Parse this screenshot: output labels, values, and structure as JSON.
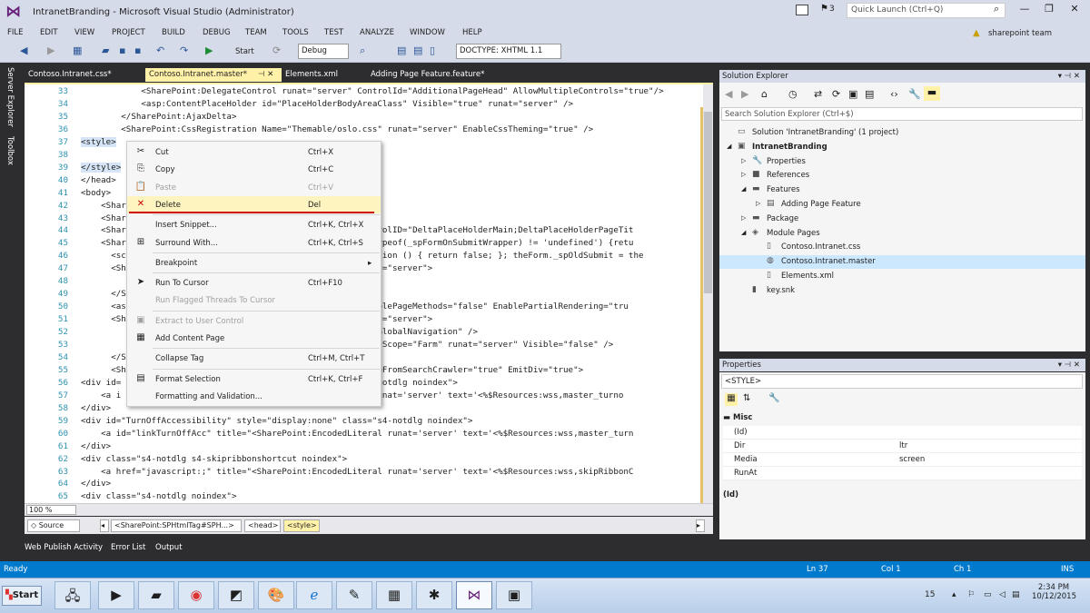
{
  "window": {
    "title": "IntranetBranding - Microsoft Visual Studio (Administrator)",
    "notification_count": "3",
    "quick_launch_placeholder": "Quick Launch (Ctrl+Q)",
    "user": "sharepoint team"
  },
  "menu": [
    "FILE",
    "EDIT",
    "VIEW",
    "PROJECT",
    "BUILD",
    "DEBUG",
    "TEAM",
    "TOOLS",
    "TEST",
    "ANALYZE",
    "WINDOW",
    "HELP"
  ],
  "toolbar": {
    "start_label": "Start",
    "config": "Debug",
    "doctype": "DOCTYPE: XHTML 1.1"
  },
  "side_tabs": [
    "Server Explorer",
    "Toolbox"
  ],
  "doc_tabs": [
    {
      "label": "Contoso.Intranet.css*"
    },
    {
      "label": "Contoso.Intranet.master*"
    },
    {
      "label": "Elements.xml"
    },
    {
      "label": "Adding Page Feature.feature*"
    }
  ],
  "editor": {
    "lines": [
      {
        "n": "33",
        "t": "<SharePoint:DelegateControl runat=\"server\" ControlId=\"AdditionalPageHead\" AllowMultipleControls=\"true\"/>",
        "i": "            "
      },
      {
        "n": "34",
        "t": "<asp:ContentPlaceHolder id=\"PlaceHolderBodyAreaClass\" Visible=\"true\" runat=\"server\" />",
        "i": "            "
      },
      {
        "n": "35",
        "t": "</SharePoint:AjaxDelta>",
        "i": "        "
      },
      {
        "n": "36",
        "t": "<SharePoint:CssRegistration Name=\"Themable/oslo.css\" runat=\"server\" EnableCssTheming=\"true\" />",
        "i": "        "
      },
      {
        "n": "37",
        "t": "<style>",
        "i": ""
      },
      {
        "n": "38",
        "t": "",
        "i": ""
      },
      {
        "n": "39",
        "t": "</style>",
        "i": ""
      },
      {
        "n": "40",
        "t": "</head>",
        "i": ""
      },
      {
        "n": "41",
        "t": "<body>",
        "i": ""
      },
      {
        "n": "42",
        "t": "<Share",
        "i": "    "
      },
      {
        "n": "43",
        "t": "<Share",
        "i": "    "
      },
      {
        "n": "44",
        "t": "<Share                                           erControlID=\"DeltaPlaceHolderMain;DeltaPlaceHolderPageTit",
        "i": "    "
      },
      {
        "n": "45",
        "t": "<Share                                           \"if (typeof(_spFormOnSubmitWrapper) != 'undefined') {retu",
        "i": "    "
      },
      {
        "n": "46",
        "t": "<scr                                             function () { return false; }; theForm._spOldSubmit = the",
        "i": "      "
      },
      {
        "n": "47",
        "t": "<Sha                                             runat=\"server\">",
        "i": "      "
      },
      {
        "n": "48",
        "t": "",
        "i": ""
      },
      {
        "n": "49",
        "t": "</Sh",
        "i": "      "
      },
      {
        "n": "50",
        "t": "<asp                                           r\" EnablePageMethods=\"false\" EnablePartialRendering=\"tru",
        "i": "      "
      },
      {
        "n": "51",
        "t": "<Sha                                             runat=\"server\">",
        "i": "      "
      },
      {
        "n": "52",
        "t": "                                                 ontrolId=\"GlobalNavigation\" />",
        "i": ""
      },
      {
        "n": "53",
        "t": "                                                 SiteLink3\" Scope=\"Farm\" runat=\"server\" Visible=\"false\" />",
        "i": ""
      },
      {
        "n": "54",
        "t": "</Sh",
        "i": "      "
      },
      {
        "n": "55",
        "t": "<Sha                                            \" HideFromSearchCrawler=\"true\" EmitDiv=\"true\">",
        "i": "      "
      },
      {
        "n": "56",
        "t": "<div id=                                          lass=\"s4-notdlg noindex\">",
        "i": ""
      },
      {
        "n": "57",
        "t": "<a i                                           iteral runat='server' text='<%$Resources:wss,master_turno",
        "i": "    "
      },
      {
        "n": "58",
        "t": "</div>",
        "i": ""
      },
      {
        "n": "59",
        "t": "<div id=\"TurnOffAccessibility\" style=\"display:none\" class=\"s4-notdlg noindex\">",
        "i": ""
      },
      {
        "n": "60",
        "t": "<a id=\"linkTurnOffAcc\" title=\"<SharePoint:EncodedLiteral runat='server' text='<%$Resources:wss,master_turn",
        "i": "    "
      },
      {
        "n": "61",
        "t": "</div>",
        "i": ""
      },
      {
        "n": "62",
        "t": "<div class=\"s4-notdlg s4-skipribbonshortcut noindex\">",
        "i": ""
      },
      {
        "n": "63",
        "t": "<a href=\"javascript:;\" title=\"<SharePoint:EncodedLiteral runat='server' text='<%$Resources:wss,skipRibbonC",
        "i": "    "
      },
      {
        "n": "64",
        "t": "</div>",
        "i": ""
      },
      {
        "n": "65",
        "t": "<div class=\"s4-notdlg noindex\">",
        "i": ""
      }
    ],
    "zoom": "100 %",
    "source_tab": "Source",
    "breadcrumbs": [
      "<SharePoint:SPHtmlTag#SPH...>",
      "<head>",
      "<style>"
    ]
  },
  "context_menu": [
    {
      "icon": "scissors-icon",
      "glyph": "✂",
      "label": "Cut",
      "shortcut": "Ctrl+X",
      "disabled": false
    },
    {
      "icon": "copy-icon",
      "glyph": "⎘",
      "label": "Copy",
      "shortcut": "Ctrl+C",
      "disabled": false
    },
    {
      "icon": "paste-icon",
      "glyph": "📋",
      "label": "Paste",
      "shortcut": "Ctrl+V",
      "disabled": true
    },
    {
      "icon": "delete-icon",
      "glyph": "✕",
      "label": "Delete",
      "shortcut": "Del",
      "disabled": false,
      "highlight": true
    },
    {
      "sep": true
    },
    {
      "icon": "snippet-icon",
      "glyph": "",
      "label": "Insert Snippet...",
      "shortcut": "Ctrl+K, Ctrl+X",
      "disabled": false
    },
    {
      "icon": "surround-icon",
      "glyph": "⊞",
      "label": "Surround With...",
      "shortcut": "Ctrl+K, Ctrl+S",
      "disabled": false
    },
    {
      "sep": true
    },
    {
      "icon": "",
      "glyph": "",
      "label": "Breakpoint",
      "shortcut": "▸",
      "disabled": false
    },
    {
      "sep": true
    },
    {
      "icon": "run-cursor-icon",
      "glyph": "➤",
      "label": "Run To Cursor",
      "shortcut": "Ctrl+F10",
      "disabled": false
    },
    {
      "icon": "run-flagged-icon",
      "glyph": "",
      "label": "Run Flagged Threads To Cursor",
      "shortcut": "",
      "disabled": true
    },
    {
      "sep": true
    },
    {
      "icon": "extract-icon",
      "glyph": "▣",
      "label": "Extract to User Control",
      "shortcut": "",
      "disabled": true
    },
    {
      "icon": "add-page-icon",
      "glyph": "▦",
      "label": "Add Content Page",
      "shortcut": "",
      "disabled": false
    },
    {
      "sep": true
    },
    {
      "icon": "",
      "glyph": "",
      "label": "Collapse Tag",
      "shortcut": "Ctrl+M, Ctrl+T",
      "disabled": false
    },
    {
      "sep": true
    },
    {
      "icon": "format-icon",
      "glyph": "▤",
      "label": "Format Selection",
      "shortcut": "Ctrl+K, Ctrl+F",
      "disabled": false
    },
    {
      "icon": "",
      "glyph": "",
      "label": "Formatting and Validation...",
      "shortcut": "",
      "disabled": false
    }
  ],
  "solution_explorer": {
    "title": "Solution Explorer",
    "search_placeholder": "Search Solution Explorer (Ctrl+$)",
    "nodes": [
      {
        "label": "Solution 'IntranetBranding' (1 project)",
        "level": 0,
        "icon": "solution-icon",
        "glyph": "▭",
        "arrow": ""
      },
      {
        "label": "IntranetBranding",
        "level": 0,
        "icon": "project-icon",
        "glyph": "▣",
        "arrow": "◢",
        "bold": true
      },
      {
        "label": "Properties",
        "level": 1,
        "icon": "wrench-icon",
        "glyph": "🔧",
        "arrow": "▷"
      },
      {
        "label": "References",
        "level": 1,
        "icon": "references-icon",
        "glyph": "■",
        "arrow": "▷"
      },
      {
        "label": "Features",
        "level": 1,
        "icon": "folder-icon",
        "glyph": "▬",
        "arrow": "◢"
      },
      {
        "label": "Adding Page Feature",
        "level": 2,
        "icon": "feature-icon",
        "glyph": "▤",
        "arrow": "▷"
      },
      {
        "label": "Package",
        "level": 1,
        "icon": "package-icon",
        "glyph": "▬",
        "arrow": "▷"
      },
      {
        "label": "Module Pages",
        "level": 1,
        "icon": "module-icon",
        "glyph": "◈",
        "arrow": "◢"
      },
      {
        "label": "Contoso.Intranet.css",
        "level": 2,
        "icon": "css-file-icon",
        "glyph": "▯",
        "arrow": ""
      },
      {
        "label": "Contoso.Intranet.master",
        "level": 2,
        "icon": "master-file-icon",
        "glyph": "◍",
        "arrow": "",
        "selected": true
      },
      {
        "label": "Elements.xml",
        "level": 2,
        "icon": "xml-file-icon",
        "glyph": "▯",
        "arrow": ""
      },
      {
        "label": "key.snk",
        "level": 1,
        "icon": "key-icon",
        "glyph": "▮",
        "arrow": ""
      }
    ]
  },
  "properties": {
    "title": "Properties",
    "object": "<STYLE>",
    "category": "Misc",
    "rows": [
      {
        "name": "(Id)",
        "value": ""
      },
      {
        "name": "Dir",
        "value": "ltr"
      },
      {
        "name": "Media",
        "value": "screen"
      },
      {
        "name": "RunAt",
        "value": ""
      }
    ],
    "desc_title": "(Id)"
  },
  "bottom_tabs": [
    "Web Publish Activity",
    "Error List",
    "Output"
  ],
  "status": {
    "ready": "Ready",
    "ln": "Ln 37",
    "col": "Col 1",
    "ch": "Ch 1",
    "ins": "INS"
  },
  "taskbar": {
    "start": "Start",
    "clock_time": "2:34 PM",
    "clock_date": "10/12/2015",
    "tray_num": "15"
  }
}
